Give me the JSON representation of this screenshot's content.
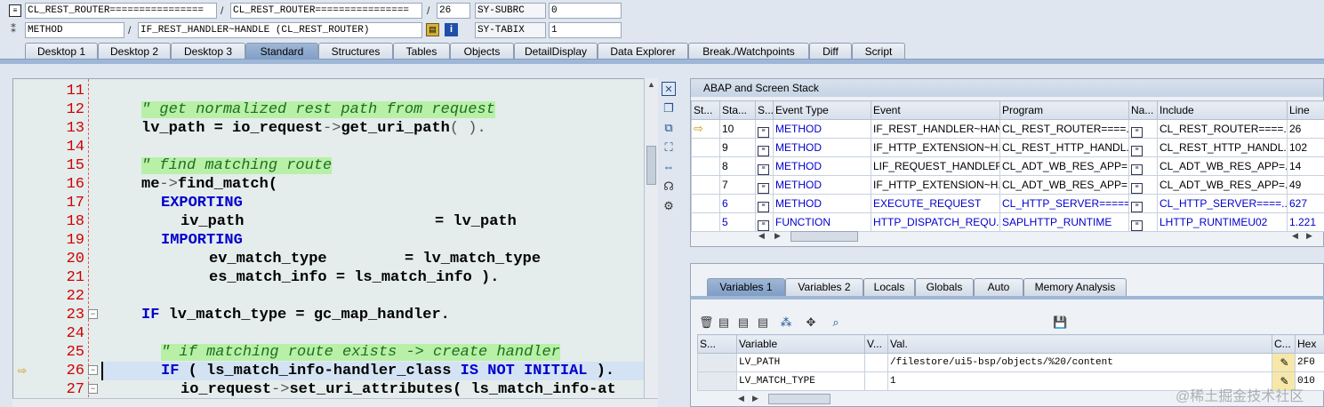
{
  "top": {
    "row1": {
      "field1": "CL_REST_ROUTER================",
      "sep1": "/",
      "field2": "CL_REST_ROUTER================",
      "sep2": "/",
      "line": "26",
      "sysvar": "SY-SUBRC",
      "sysval": "0"
    },
    "row2": {
      "field1": "METHOD",
      "sep1": "/",
      "field2": "IF_REST_HANDLER~HANDLE (CL_REST_ROUTER)",
      "sysvar": "SY-TABIX",
      "sysval": "1"
    }
  },
  "tabs": [
    "Desktop 1",
    "Desktop 2",
    "Desktop 3",
    "Standard",
    "Structures",
    "Tables",
    "Objects",
    "DetailDisplay",
    "Data Explorer",
    "Break./Watchpoints",
    "Diff",
    "Script"
  ],
  "active_tab": "Standard",
  "editor": {
    "line_numbers": [
      "11",
      "12",
      "13",
      "14",
      "15",
      "16",
      "17",
      "18",
      "19",
      "20",
      "21",
      "22",
      "23",
      "24",
      "25",
      "26",
      "27"
    ],
    "lines": {
      "l12": "\" get normalized rest path from request",
      "l13a": "lv_path ",
      "l13b": "= io_request",
      "l13c": "->",
      "l13d": "get_uri_path",
      "l13e": "( ).",
      "l15": "\" find matching route",
      "l16a": "me",
      "l16b": "->",
      "l16c": "find_match(",
      "l17": "EXPORTING",
      "l18a": "iv_path",
      "l18b": "= lv_path",
      "l19": "IMPORTING",
      "l20a": "ev_match_type",
      "l20b": "= lv_match_type",
      "l21a": "es_match_info = ls_match_info ).",
      "l23a": "IF",
      "l23b": " lv_match_type = gc_map_handler.",
      "l25": "\" if matching route exists -> create handler",
      "l26a": "IF",
      "l26b": " ( ls_match_info-handler_class ",
      "l26c": "IS NOT INITIAL",
      "l26d": " ).",
      "l27a": "io_request",
      "l27b": "->",
      "l27c": "set_uri_attributes( ls_match_info-at"
    }
  },
  "stack": {
    "title": "ABAP and Screen Stack",
    "headers": [
      "St...",
      "Sta...",
      "S...",
      "Event Type",
      "Event",
      "Program",
      "Na...",
      "Include",
      "Line"
    ],
    "rows": [
      {
        "level": "10",
        "type": "METHOD",
        "event": "IF_REST_HANDLER~HAN...",
        "program": "CL_REST_ROUTER====...",
        "include": "CL_REST_ROUTER====...",
        "line": "26",
        "current": true
      },
      {
        "level": "9",
        "type": "METHOD",
        "event": "IF_HTTP_EXTENSION~H...",
        "program": "CL_REST_HTTP_HANDL...",
        "include": "CL_REST_HTTP_HANDL...",
        "line": "102",
        "current": false
      },
      {
        "level": "8",
        "type": "METHOD",
        "event": "LIF_REQUEST_HANDLER...",
        "program": "CL_ADT_WB_RES_APP=...",
        "include": "CL_ADT_WB_RES_APP=...",
        "line": "14",
        "current": false
      },
      {
        "level": "7",
        "type": "METHOD",
        "event": "IF_HTTP_EXTENSION~H...",
        "program": "CL_ADT_WB_RES_APP=...",
        "include": "CL_ADT_WB_RES_APP=...",
        "line": "49",
        "current": false
      },
      {
        "level": "6",
        "type": "METHOD",
        "event": "EXECUTE_REQUEST",
        "program": "CL_HTTP_SERVER=====...",
        "include": "CL_HTTP_SERVER====...",
        "line": "627",
        "current": false
      },
      {
        "level": "5",
        "type": "FUNCTION",
        "event": "HTTP_DISPATCH_REQU...",
        "program": "SAPLHTTP_RUNTIME",
        "include": "LHTTP_RUNTIMEU02",
        "line": "1.221",
        "current": false
      }
    ]
  },
  "var_tabs": [
    "Variables 1",
    "Variables 2",
    "Locals",
    "Globals",
    "Auto",
    "Memory Analysis"
  ],
  "variables": {
    "headers": [
      "S...",
      "Variable",
      "V...",
      "Val.",
      "C...",
      "Hex"
    ],
    "rows": [
      {
        "name": "LV_PATH",
        "value": "/filestore/ui5-bsp/objects/%20/content",
        "hex": "2F0"
      },
      {
        "name": "LV_MATCH_TYPE",
        "value": "1",
        "hex": "010"
      }
    ]
  },
  "watermark": "@稀土掘金技术社区"
}
